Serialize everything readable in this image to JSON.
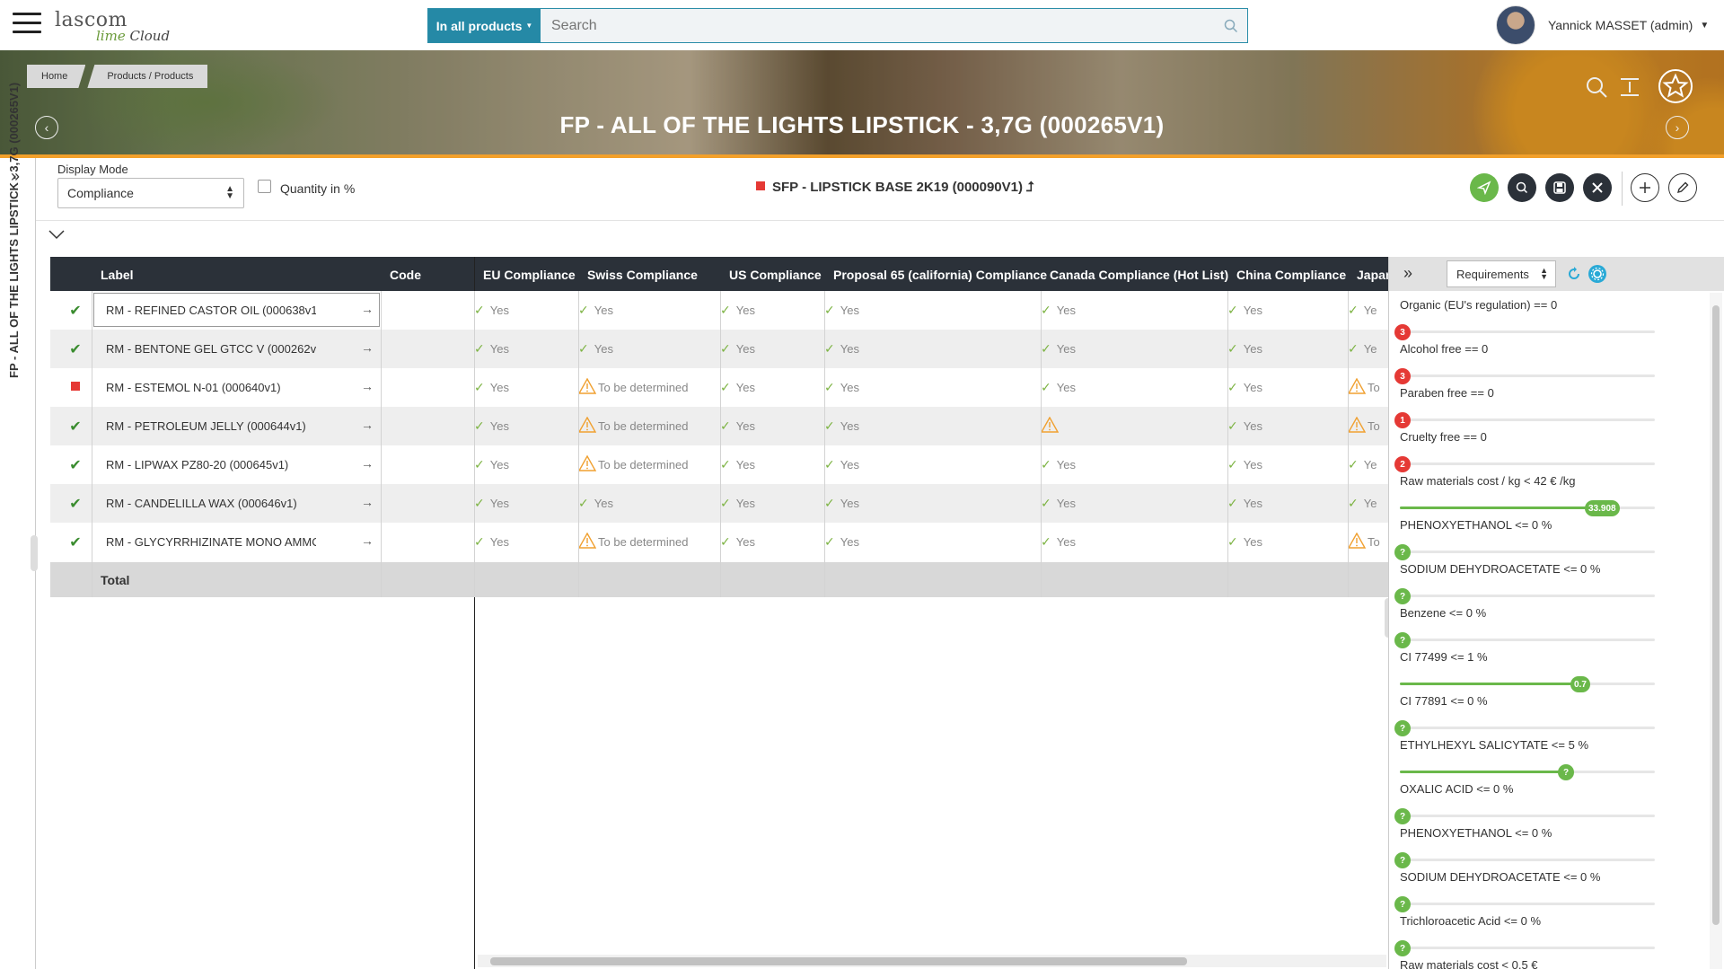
{
  "header": {
    "logo_main": "lascom",
    "logo_sub_a": "lime",
    "logo_sub_b": "Cloud",
    "search_scope": "In all products",
    "search_placeholder": "Search",
    "user_name": "Yannick MASSET (admin)"
  },
  "banner": {
    "breadcrumb": [
      "Home",
      "Products / Products"
    ],
    "title": "FP - ALL OF THE LIGHTS LIPSTICK - 3,7G (000265V1)"
  },
  "sidebar": {
    "vertical_title": "FP - ALL OF THE LIGHTS LIPSTICK - 3,7G (000265V1)"
  },
  "toolbar": {
    "display_mode_label": "Display Mode",
    "display_mode_value": "Compliance",
    "quantity_label": "Quantity in %",
    "quantity_checked": false,
    "sfp_title": "SFP - LIPSTICK BASE 2K19 (000090V1)",
    "button_colors": {
      "send": "#6ab84a",
      "dark": "#2b3139"
    }
  },
  "table": {
    "columns": [
      "Label",
      "Code",
      "EU Compliance",
      "Swiss Compliance",
      "US Compliance",
      "Proposal 65 (california) Compliance",
      "Canada Compliance (Hot List)",
      "China Compliance",
      "Japan"
    ],
    "rows": [
      {
        "status": "ok",
        "label": "RM - REFINED CASTOR OIL (000638v1",
        "cells": [
          "Yes",
          "Yes",
          "Yes",
          "Yes",
          "Yes",
          "Yes",
          "Ye"
        ]
      },
      {
        "status": "ok",
        "label": "RM - BENTONE GEL GTCC V (000262v",
        "cells": [
          "Yes",
          "Yes",
          "Yes",
          "Yes",
          "Yes",
          "Yes",
          "Ye"
        ]
      },
      {
        "status": "flag",
        "label": "RM - ESTEMOL N-01 (000640v1)",
        "cells": [
          "Yes",
          "To be determined",
          "Yes",
          "Yes",
          "Yes",
          "Yes",
          "To"
        ]
      },
      {
        "status": "ok",
        "label": "RM - PETROLEUM JELLY (000644v1)",
        "cells": [
          "Yes",
          "To be determined",
          "Yes",
          "Yes",
          "",
          "Yes",
          "To"
        ]
      },
      {
        "status": "ok",
        "label": "RM - LIPWAX PZ80-20 (000645v1)",
        "cells": [
          "Yes",
          "To be determined",
          "Yes",
          "Yes",
          "Yes",
          "Yes",
          "Ye"
        ]
      },
      {
        "status": "ok",
        "label": "RM - CANDELILLA WAX (000646v1)",
        "cells": [
          "Yes",
          "Yes",
          "Yes",
          "Yes",
          "Yes",
          "Yes",
          "Ye"
        ]
      },
      {
        "status": "ok",
        "label": "RM - GLYCYRRHIZINATE MONO AMMO",
        "cells": [
          "Yes",
          "To be determined",
          "Yes",
          "Yes",
          "Yes",
          "Yes",
          "To"
        ]
      }
    ],
    "total_label": "Total"
  },
  "requirements": {
    "selector": "Requirements",
    "items": [
      {
        "label": "Organic (EU's regulation) == 0",
        "badge": "3",
        "badge_color": "red",
        "level": 0
      },
      {
        "label": "Alcohol free == 0",
        "badge": "3",
        "badge_color": "red",
        "level": 0
      },
      {
        "label": "Paraben free == 0",
        "badge": "1",
        "badge_color": "red",
        "level": 0
      },
      {
        "label": "Cruelty free == 0",
        "badge": "2",
        "badge_color": "red",
        "level": 0
      },
      {
        "label": "Raw materials cost / kg < 42 € /kg",
        "badge": "33.908",
        "badge_color": "green",
        "level": 0.81
      },
      {
        "label": "PHENOXYETHANOL <= 0 %",
        "badge": "?",
        "badge_color": "green",
        "level": 0
      },
      {
        "label": "SODIUM DEHYDROACETATE <= 0 %",
        "badge": "?",
        "badge_color": "green",
        "level": 0
      },
      {
        "label": "Benzene <= 0 %",
        "badge": "?",
        "badge_color": "green",
        "level": 0
      },
      {
        "label": "CI 77499 <= 1 %",
        "badge": "0.7",
        "badge_color": "green",
        "level": 0.7
      },
      {
        "label": "CI 77891 <= 0 %",
        "badge": "?",
        "badge_color": "green",
        "level": 0
      },
      {
        "label": "ETHYLHEXYL SALICYTATE <= 5 %",
        "badge": "?",
        "badge_color": "green",
        "level": 0.65
      },
      {
        "label": "OXALIC ACID <= 0 %",
        "badge": "?",
        "badge_color": "green",
        "level": 0
      },
      {
        "label": "PHENOXYETHANOL <= 0 %",
        "badge": "?",
        "badge_color": "green",
        "level": 0
      },
      {
        "label": "SODIUM DEHYDROACETATE <= 0 %",
        "badge": "?",
        "badge_color": "green",
        "level": 0
      },
      {
        "label": "Trichloroacetic Acid <= 0 %",
        "badge": "?",
        "badge_color": "green",
        "level": 0
      },
      {
        "label": "Raw materials cost < 0.5 €",
        "badge": "",
        "badge_color": "green",
        "level": 0
      }
    ]
  }
}
